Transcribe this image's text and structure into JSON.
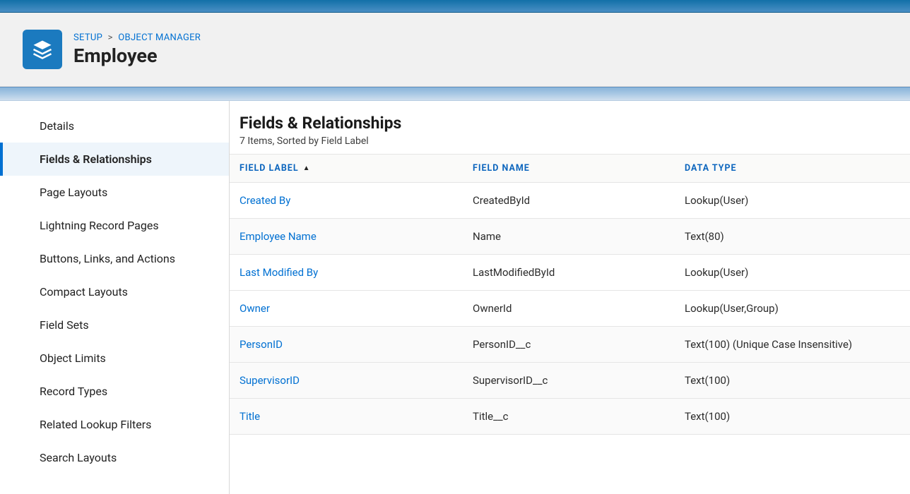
{
  "breadcrumb": {
    "setup": "SETUP",
    "object_manager": "OBJECT MANAGER"
  },
  "page_title": "Employee",
  "sidebar": {
    "items": [
      {
        "label": "Details"
      },
      {
        "label": "Fields & Relationships"
      },
      {
        "label": "Page Layouts"
      },
      {
        "label": "Lightning Record Pages"
      },
      {
        "label": "Buttons, Links, and Actions"
      },
      {
        "label": "Compact Layouts"
      },
      {
        "label": "Field Sets"
      },
      {
        "label": "Object Limits"
      },
      {
        "label": "Record Types"
      },
      {
        "label": "Related Lookup Filters"
      },
      {
        "label": "Search Layouts"
      }
    ],
    "active_index": 1
  },
  "main": {
    "title": "Fields & Relationships",
    "subtitle": "7 Items, Sorted by Field Label",
    "columns": {
      "field_label": "FIELD LABEL",
      "field_name": "FIELD NAME",
      "data_type": "DATA TYPE"
    },
    "rows": [
      {
        "label": "Created By",
        "name": "CreatedById",
        "type": "Lookup(User)"
      },
      {
        "label": "Employee Name",
        "name": "Name",
        "type": "Text(80)"
      },
      {
        "label": "Last Modified By",
        "name": "LastModifiedById",
        "type": "Lookup(User)"
      },
      {
        "label": "Owner",
        "name": "OwnerId",
        "type": "Lookup(User,Group)"
      },
      {
        "label": "PersonID",
        "name": "PersonID__c",
        "type": "Text(100) (Unique Case Insensitive)"
      },
      {
        "label": "SupervisorID",
        "name": "SupervisorID__c",
        "type": "Text(100)"
      },
      {
        "label": "Title",
        "name": "Title__c",
        "type": "Text(100)"
      }
    ]
  }
}
